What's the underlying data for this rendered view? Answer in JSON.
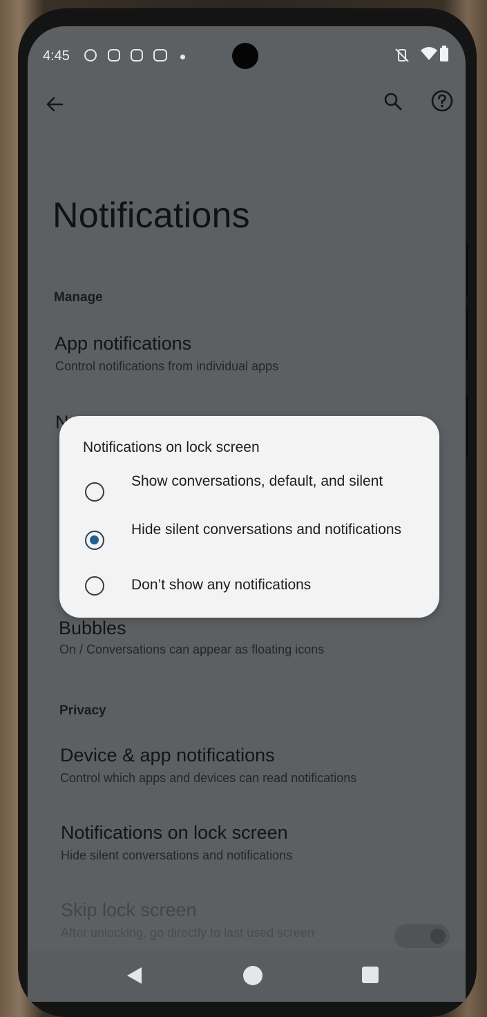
{
  "status_bar": {
    "time": "4:45",
    "icons": [
      "notification-icon-1",
      "notification-icon-2",
      "notification-icon-3",
      "notification-icon-4",
      "more-dot-icon",
      "vibrate-off-icon",
      "wifi-icon",
      "battery-icon"
    ]
  },
  "toolbar": {
    "back_icon": "arrow-left-icon",
    "search_icon": "search-icon",
    "help_icon": "help-circle-icon"
  },
  "page": {
    "title": "Notifications"
  },
  "sections": {
    "manage": {
      "label": "Manage",
      "items": [
        {
          "title": "App notifications",
          "subtitle": "Control notifications from individual apps"
        },
        {
          "title": "N"
        },
        {
          "title": "Bubbles",
          "subtitle": "On / Conversations can appear as floating icons"
        }
      ]
    },
    "privacy": {
      "label": "Privacy",
      "items": [
        {
          "title": "Device & app notifications",
          "subtitle": "Control which apps and devices can read notifications"
        },
        {
          "title": "Notifications on lock screen",
          "subtitle": "Hide silent conversations and notifications"
        },
        {
          "title": "Skip lock screen",
          "subtitle": "After unlocking, go directly to last used screen"
        }
      ]
    }
  },
  "dialog": {
    "title": "Notifications on lock screen",
    "options": [
      {
        "label": "Show conversations, default, and silent",
        "selected": false
      },
      {
        "label": "Hide silent conversations and notifications",
        "selected": true
      },
      {
        "label": "Don’t show any notifications",
        "selected": false
      }
    ]
  },
  "nav_bar": {
    "back_icon": "nav-back-triangle-icon",
    "home_icon": "nav-home-circle-icon",
    "recents_icon": "nav-recents-square-icon"
  },
  "colors": {
    "scrim_background": "#5d6063",
    "dialog_background": "#f3f3f3",
    "radio_selected": "#1f5f8f"
  }
}
